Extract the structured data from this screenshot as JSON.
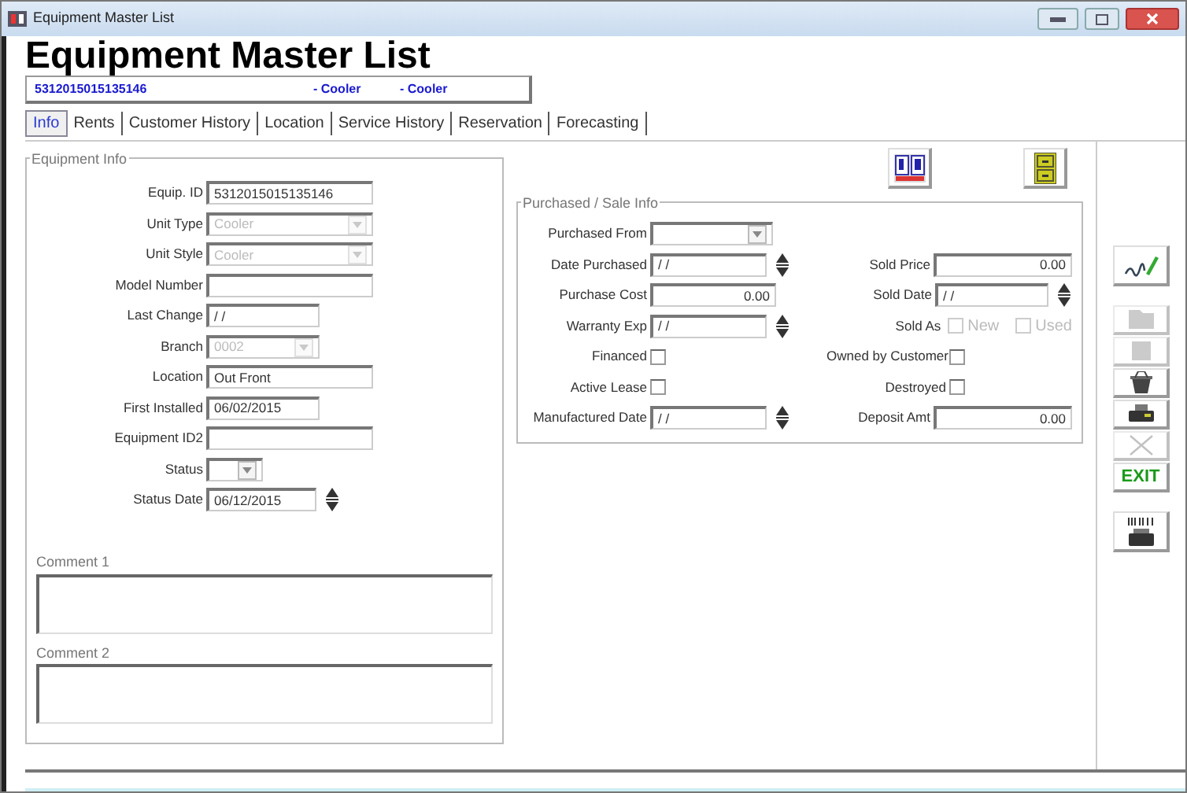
{
  "window": {
    "title": "Equipment Master List"
  },
  "heading": "Equipment Master List",
  "record_bar": [
    "5312015015135146",
    "- Cooler",
    "- Cooler"
  ],
  "tabs": [
    {
      "label": "Info",
      "selected": true
    },
    {
      "label": "Rents",
      "selected": false
    },
    {
      "label": "Customer History",
      "selected": false
    },
    {
      "label": "Location",
      "selected": false
    },
    {
      "label": "Service History",
      "selected": false
    },
    {
      "label": "Reservation",
      "selected": false
    },
    {
      "label": "Forecasting",
      "selected": false
    }
  ],
  "equipment_info": {
    "title": "Equipment Info",
    "fields": [
      {
        "label": "Equip. ID",
        "kind": "text",
        "value": "5312015015135146"
      },
      {
        "label": "Unit Type",
        "kind": "select",
        "value": "Cooler",
        "disabled": true
      },
      {
        "label": "Unit Style",
        "kind": "select",
        "value": "Cooler",
        "disabled": true
      },
      {
        "label": "Model Number",
        "kind": "text"
      },
      {
        "label": "Last Change",
        "kind": "text",
        "value": "/ /"
      },
      {
        "label": "Branch",
        "kind": "select",
        "value": "0002",
        "disabled": true
      },
      {
        "label": "Location",
        "kind": "text",
        "value": "Out Front"
      },
      {
        "label": "First Installed",
        "kind": "text",
        "value": "06/02/2015"
      },
      {
        "label": "Equipment ID2",
        "kind": "text"
      },
      {
        "label": "Status",
        "kind": "select",
        "disabled": false
      },
      {
        "label": "Status Date",
        "kind": "date",
        "value": "06/12/2015"
      }
    ]
  },
  "comments": [
    {
      "label": "Comment 1"
    },
    {
      "label": "Comment 2"
    }
  ],
  "purchase_info": {
    "title": "Purchased / Sale Info",
    "rows": [
      {
        "left": {
          "label": "Purchased From",
          "kind": "select",
          "disabled": false
        }
      },
      {
        "left": {
          "label": "Date Purchased",
          "kind": "date",
          "value": "/ /"
        },
        "right": {
          "label": "Sold Price",
          "kind": "number",
          "value": "0.00"
        }
      },
      {
        "left": {
          "label": "Purchase Cost",
          "kind": "number",
          "value": "0.00"
        },
        "right": {
          "label": "Sold Date",
          "kind": "date",
          "value": "/ /"
        }
      },
      {
        "left": {
          "label": "Warranty Exp",
          "kind": "date",
          "value": "/ /"
        },
        "right": {
          "label": "Sold As",
          "kind": "checkgroup",
          "disabled": true,
          "options": [
            {
              "label": "New",
              "checked": false
            },
            {
              "label": "Used",
              "checked": false
            }
          ]
        }
      },
      {
        "left": {
          "label": "Financed",
          "kind": "checkbox",
          "checked": false
        },
        "right": {
          "label": "Owned by Customer",
          "kind": "checkbox",
          "checked": false
        }
      },
      {
        "left": {
          "label": "Active Lease",
          "kind": "checkbox",
          "checked": false
        },
        "right": {
          "label": "Destroyed",
          "kind": "checkbox",
          "checked": false
        }
      },
      {
        "left": {
          "label": "Manufactured Date",
          "kind": "date",
          "value": "/ /"
        },
        "right": {
          "label": "Deposit Amt",
          "kind": "number",
          "value": "0.00"
        }
      }
    ]
  },
  "toolbar": [
    {
      "kind": "signature",
      "disabled": false
    },
    {
      "kind": "folder",
      "disabled": true
    },
    {
      "kind": "square",
      "disabled": true
    },
    {
      "kind": "basket",
      "disabled": false
    },
    {
      "kind": "printer",
      "disabled": false
    },
    {
      "kind": "cross",
      "disabled": true
    },
    {
      "kind": "exit",
      "label": "EXIT",
      "disabled": false
    },
    {
      "kind": "barcode-printer",
      "disabled": false
    }
  ]
}
